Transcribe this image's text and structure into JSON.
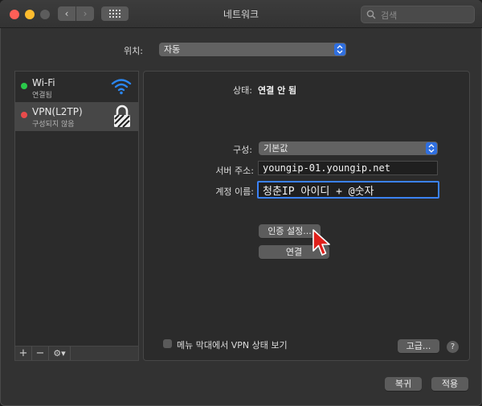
{
  "window": {
    "title": "네트워크"
  },
  "toolbar": {
    "back": "‹",
    "forward": "›",
    "search_placeholder": "검색"
  },
  "location": {
    "label": "위치:",
    "value": "자동"
  },
  "services": [
    {
      "name": "Wi-Fi",
      "status": "연결됨",
      "status_color": "#2ac94a",
      "icon": "wifi-icon"
    },
    {
      "name": "VPN(L2TP)",
      "status": "구성되지 않음",
      "status_color": "#e94b4b",
      "icon": "lock-icon"
    }
  ],
  "sidebar_tools": {
    "add": "+",
    "remove": "−",
    "action": "⚙▾"
  },
  "detail": {
    "status_label": "상태:",
    "status_value": "연결 안 됨",
    "config_label": "구성:",
    "config_value": "기본값",
    "server_label": "서버 주소:",
    "server_value": "youngip-01.youngip.net",
    "account_label": "계정 이름:",
    "account_value": "청춘IP 아이디 + @숫자",
    "auth_button": "인증 설정...",
    "connect_button": "연결",
    "menubar_checkbox_label": "메뉴 막대에서 VPN 상태 보기",
    "advanced_button": "고급...",
    "help_button": "?"
  },
  "footer": {
    "revert_button": "복귀",
    "apply_button": "적용"
  },
  "colors": {
    "accent": "#2f6fe0",
    "focus": "#3b82f7",
    "cursor": "#e0201b"
  }
}
